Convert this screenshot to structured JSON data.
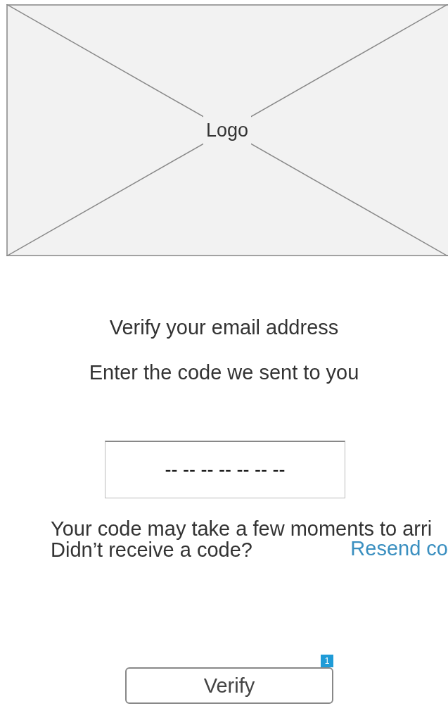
{
  "logo": {
    "label": "Logo"
  },
  "heading": "Verify your email address",
  "instruction": "Enter the code we sent to you",
  "code_field": {
    "placeholder": "-- -- -- -- -- -- --"
  },
  "notice": "Your code may take a few moments to arri",
  "resend": {
    "question": "Didn’t receive a code?",
    "link": "Resend co"
  },
  "verify_button": {
    "label": "Verify",
    "badge": "1"
  }
}
